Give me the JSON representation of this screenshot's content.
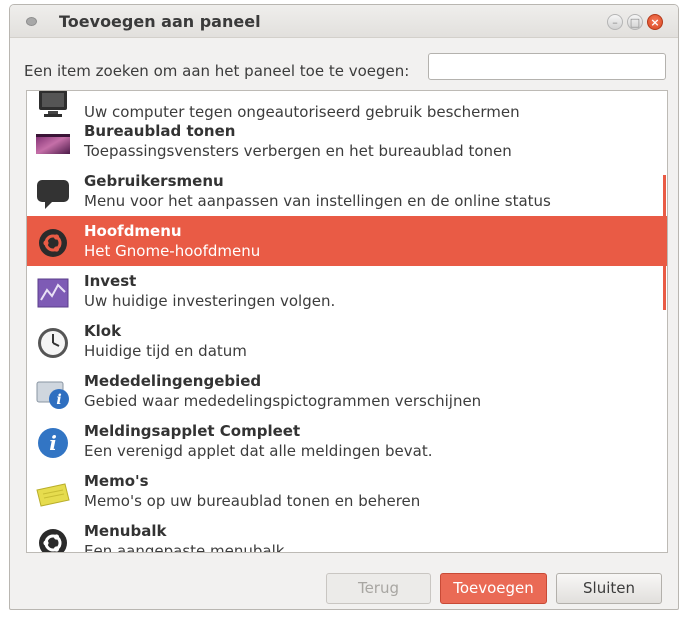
{
  "window": {
    "title": "Toevoegen aan paneel"
  },
  "search": {
    "label": "Een item zoeken om aan het paneel toe te voegen:",
    "value": "",
    "placeholder": ""
  },
  "items": [
    {
      "name": "",
      "desc": "Uw computer tegen ongeautoriseerd gebruik beschermen",
      "icon": "monitor-lock-icon"
    },
    {
      "name": "Bureaublad tonen",
      "desc": "Toepassingsvensters verbergen en het bureaublad tonen",
      "icon": "desktop-icon"
    },
    {
      "name": "Gebruikersmenu",
      "desc": "Menu voor het aanpassen van instellingen en de online status",
      "icon": "speech-bubble-icon"
    },
    {
      "name": "Hoofdmenu",
      "desc": "Het Gnome-hoofdmenu",
      "icon": "ubuntu-logo-icon",
      "selected": true
    },
    {
      "name": "Invest",
      "desc": "Uw huidige investeringen volgen.",
      "icon": "chart-icon"
    },
    {
      "name": "Klok",
      "desc": "Huidige tijd en datum",
      "icon": "clock-icon"
    },
    {
      "name": "Mededelingengebied",
      "desc": "Gebied waar mededelingspictogrammen verschijnen",
      "icon": "info-monitor-icon"
    },
    {
      "name": "Meldingsapplet Compleet",
      "desc": "Een verenigd applet dat alle meldingen bevat.",
      "icon": "info-icon"
    },
    {
      "name": "Memo's",
      "desc": "Memo's op uw bureaublad tonen en beheren",
      "icon": "sticky-note-icon"
    },
    {
      "name": "Menubalk",
      "desc": "Een aangepaste menubalk",
      "icon": "ubuntu-logo-icon"
    }
  ],
  "buttons": {
    "back": "Terug",
    "add": "Toevoegen",
    "close": "Sluiten"
  },
  "colors": {
    "accent": "#e95b45",
    "background": "#f2f1f0"
  }
}
